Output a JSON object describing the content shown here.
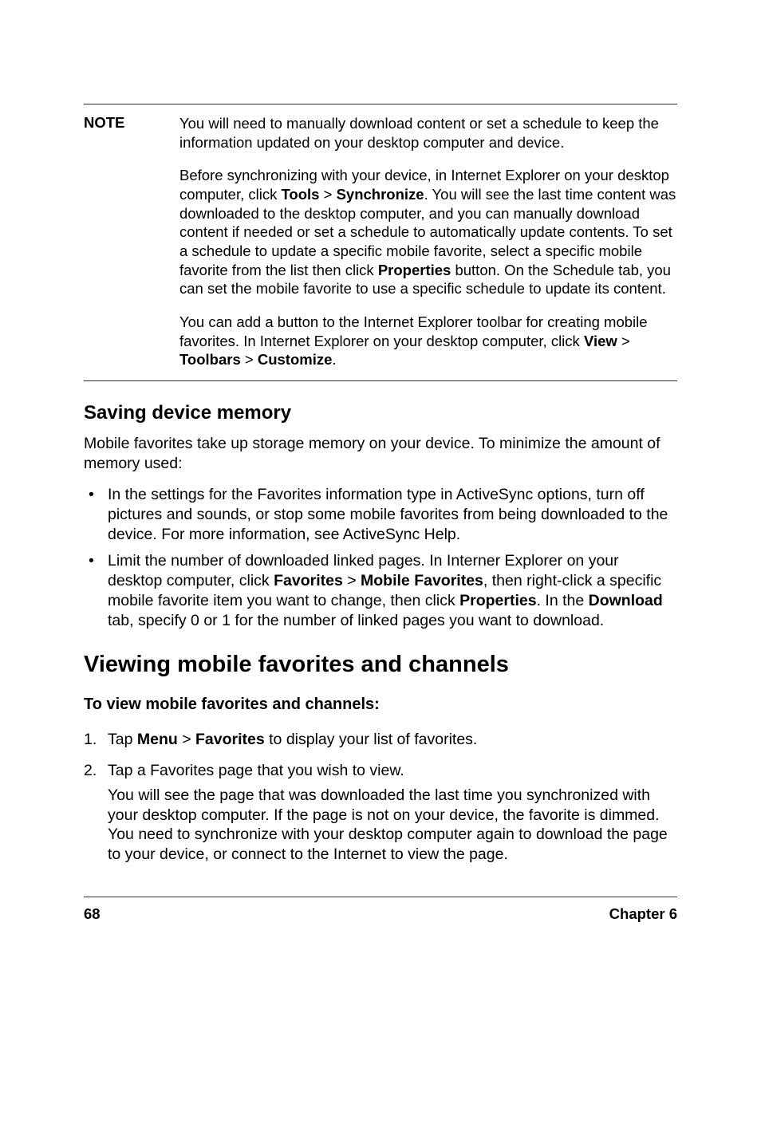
{
  "note": {
    "label": "NOTE",
    "para1_a": "You will need to manually download content or set a schedule to keep the information updated on your desktop computer and device.",
    "para2_a": "Before synchronizing with your device, in Internet Explorer on your desktop computer, click ",
    "para2_tools": "Tools",
    "para2_gt1": " > ",
    "para2_sync": "Synchronize",
    "para2_b": ". You will see the last time content was downloaded to the desktop computer, and you can manually download content if needed or set a schedule to automatically update contents. To set a schedule to update a specific mobile favorite, select a specific mobile favorite from the list then click ",
    "para2_props": "Properties",
    "para2_c": " button. On the Schedule tab, you can set the mobile favorite to use a specific schedule to update its content.",
    "para3_a": "You can add a button to the Internet Explorer toolbar for creating mobile favorites. In Internet Explorer on your desktop computer, click ",
    "para3_view": "View",
    "para3_gt1": " > ",
    "para3_toolbars": "Toolbars",
    "para3_gt2": " > ",
    "para3_customize": "Customize",
    "para3_end": "."
  },
  "saving": {
    "heading": "Saving device memory",
    "intro": "Mobile favorites take up storage memory on your device. To minimize the amount of memory used:",
    "bullet1": "In the settings for the Favorites information type in ActiveSync options, turn off pictures and sounds, or stop some mobile favorites from being downloaded to the device. For more information, see ActiveSync Help.",
    "bullet2_a": "Limit the number of downloaded linked pages. In Interner Explorer on your desktop computer, click ",
    "bullet2_fav": "Favorites",
    "bullet2_gt": " > ",
    "bullet2_mob": "Mobile Favorites",
    "bullet2_b": ", then right-click a specific mobile favorite item you want to change, then click ",
    "bullet2_props": "Properties",
    "bullet2_c": ". In the ",
    "bullet2_dl": "Download",
    "bullet2_d": " tab, specify 0 or 1 for the number of linked pages you want to download."
  },
  "viewing": {
    "heading": "Viewing mobile favorites and channels",
    "sub": "To view mobile favorites and channels:",
    "step1_a": "Tap ",
    "step1_menu": "Menu",
    "step1_gt": " > ",
    "step1_fav": "Favorites",
    "step1_b": " to display your list of favorites.",
    "step2_a": "Tap a Favorites page that you wish to view.",
    "step2_body": "You will see the page that was downloaded the last time you synchronized with your desktop computer. If the page is not on your device, the favorite is dimmed. You need to synchronize with your desktop computer again to download the page to your device, or connect to the Internet to view the page."
  },
  "footer": {
    "page": "68",
    "chapter": "Chapter 6"
  }
}
